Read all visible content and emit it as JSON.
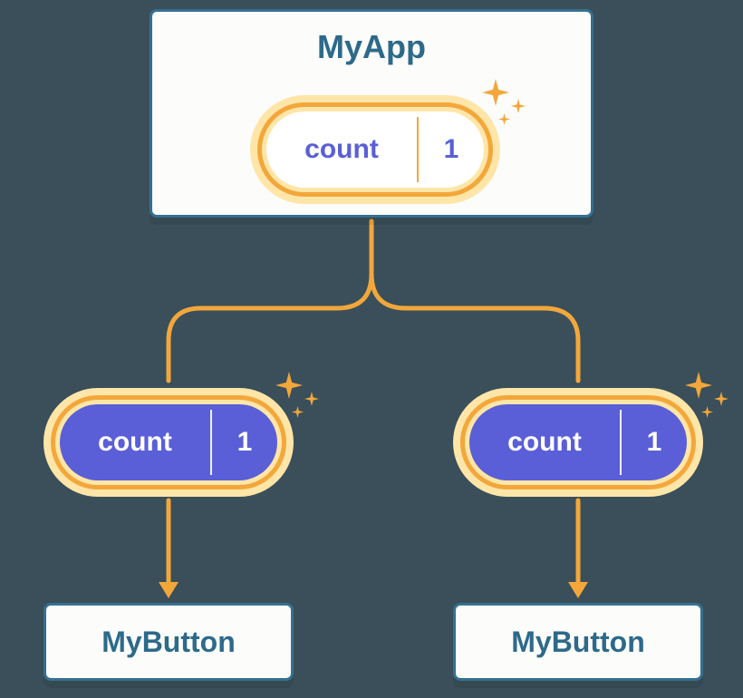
{
  "root": {
    "title": "MyApp",
    "pill": {
      "label": "count",
      "value": "1"
    }
  },
  "props": [
    {
      "label": "count",
      "value": "1"
    },
    {
      "label": "count",
      "value": "1"
    }
  ],
  "children": [
    {
      "title": "MyButton"
    },
    {
      "title": "MyButton"
    }
  ],
  "colors": {
    "box_border": "#357090",
    "box_bg": "#fcfcfa",
    "title_text": "#2d6a8a",
    "pill_halo": "#ffe6a8",
    "pill_border": "#f3a73b",
    "pill_solid": "#5a5fd7",
    "pill_text_light": "#5a5fd7",
    "pill_text_solid": "#ffffff",
    "canvas_bg": "#3a4f59"
  }
}
